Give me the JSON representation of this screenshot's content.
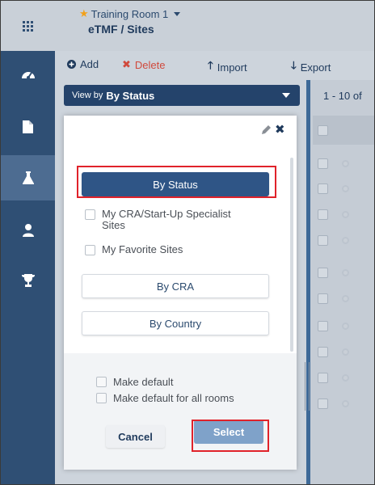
{
  "header": {
    "room_name": "Training Room 1",
    "breadcrumb": "eTMF / Sites"
  },
  "toolbar": {
    "add_label": "Add",
    "delete_label": "Delete",
    "import_label": "Import",
    "export_label": "Export"
  },
  "viewby": {
    "prefix": "View by",
    "value": "By Status"
  },
  "grid": {
    "range_label": "1 - 10 of"
  },
  "popup": {
    "options": [
      {
        "label": "By Status",
        "selected": true
      },
      {
        "label": "My CRA/Start-Up Specialist Sites"
      },
      {
        "label": "My Favorite Sites"
      },
      {
        "label": "By CRA"
      },
      {
        "label": "By Country"
      }
    ],
    "make_default_label": "Make default",
    "make_default_all_label": "Make default for all rooms",
    "cancel_label": "Cancel",
    "select_label": "Select"
  },
  "colors": {
    "nav_rail": "#2f4f74",
    "accent_primary": "#2f5586",
    "select_button": "#7fa2c9",
    "highlight_box": "#e0222a",
    "delete_red": "#d0493c",
    "favorite_star": "#f2a11b"
  },
  "icons": {
    "rail": [
      "apps-grid-icon",
      "dashboard-gauge-icon",
      "document-icon",
      "flask-icon",
      "user-icon",
      "trophy-icon"
    ],
    "toolbar": [
      "plus-circle-icon",
      "x-icon",
      "arrow-up-icon",
      "arrow-down-icon"
    ]
  }
}
